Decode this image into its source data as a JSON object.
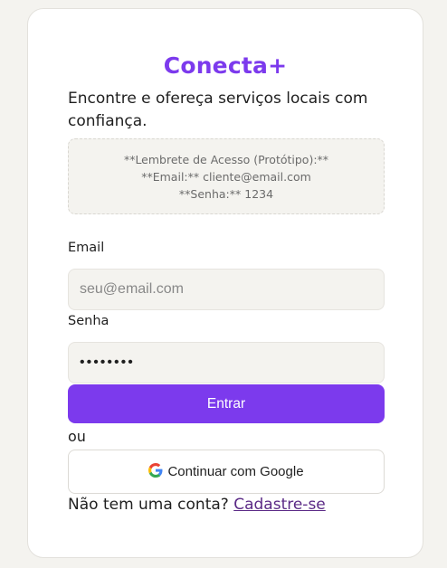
{
  "app": {
    "brand": "Conecta+",
    "tagline": "Encontre e ofereça serviços locais com confiança."
  },
  "reminder": {
    "line1": "**Lembrete de Acesso (Protótipo):**",
    "line2": "**Email:** cliente@email.com",
    "line3": "**Senha:** 1234"
  },
  "form": {
    "email_label": "Email",
    "email_placeholder": "seu@email.com",
    "email_value": "",
    "password_label": "Senha",
    "password_value": "12345678",
    "submit_label": "Entrar",
    "divider_text": "ou",
    "google_label": "Continuar com Google",
    "google_icon": "google-logo-icon"
  },
  "signup": {
    "prompt": "Não tem uma conta?",
    "link_label": "Cadastre-se"
  },
  "colors": {
    "accent": "#7c3aed",
    "background": "#f4f3ef",
    "link": "#5b2a86"
  }
}
